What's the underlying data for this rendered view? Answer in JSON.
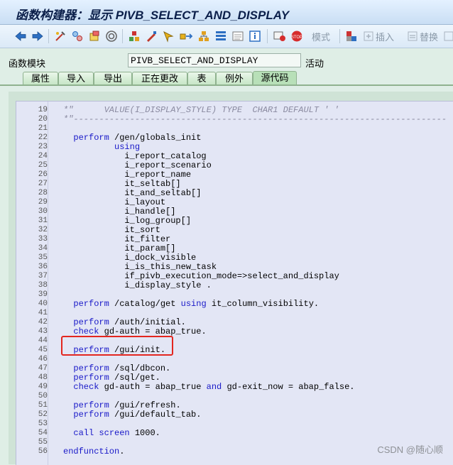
{
  "window": {
    "title": "函数构建器：显示 PIVB_SELECT_AND_DISPLAY"
  },
  "toolbar": {
    "icons": [
      "back-arrow-icon",
      "forward-arrow-icon",
      "other-object-icon",
      "display-change-icon",
      "activate-icon",
      "where-used-icon",
      "object-list-icon",
      "check-icon",
      "navigate-icon",
      "hierarchy-icon",
      "outline-icon",
      "test-icon",
      "info-icon",
      "breakpoint-icon",
      "stop-icon",
      "enhance-icon",
      "insert-icon",
      "replace-icon",
      "delete-icon"
    ],
    "pattern_label": "模式",
    "insert_label": "插入",
    "replace_label": "替换"
  },
  "module": {
    "label": "函数模块",
    "name": "PIVB_SELECT_AND_DISPLAY",
    "status": "活动"
  },
  "tabs": [
    "属性",
    "导入",
    "导出",
    "正在更改",
    "表",
    "例外",
    "源代码"
  ],
  "active_tab": "源代码",
  "code": [
    {
      "n": "19",
      "t": "*\"      VALUE(I_DISPLAY_STYLE) TYPE  CHAR1 DEFAULT ' '"
    },
    {
      "n": "20",
      "t": "*\"-------------------------------------------------------------------------"
    },
    {
      "n": "21",
      "t": ""
    },
    {
      "n": "22",
      "t": "  perform /gen/globals_init"
    },
    {
      "n": "23",
      "t": "          using"
    },
    {
      "n": "24",
      "t": "            i_report_catalog"
    },
    {
      "n": "25",
      "t": "            i_report_scenario"
    },
    {
      "n": "26",
      "t": "            i_report_name"
    },
    {
      "n": "27",
      "t": "            it_seltab[]"
    },
    {
      "n": "28",
      "t": "            it_and_seltab[]"
    },
    {
      "n": "29",
      "t": "            i_layout"
    },
    {
      "n": "30",
      "t": "            i_handle[]"
    },
    {
      "n": "31",
      "t": "            i_log_group[]"
    },
    {
      "n": "32",
      "t": "            it_sort"
    },
    {
      "n": "33",
      "t": "            it_filter"
    },
    {
      "n": "34",
      "t": "            it_param[]"
    },
    {
      "n": "35",
      "t": "            i_dock_visible"
    },
    {
      "n": "36",
      "t": "            i_is_this_new_task"
    },
    {
      "n": "37",
      "t": "            if_pivb_execution_mode=>select_and_display"
    },
    {
      "n": "38",
      "t": "            i_display_style ."
    },
    {
      "n": "39",
      "t": ""
    },
    {
      "n": "40",
      "t": "  perform /catalog/get using it_column_visibility."
    },
    {
      "n": "41",
      "t": ""
    },
    {
      "n": "42",
      "t": "  perform /auth/initial."
    },
    {
      "n": "43",
      "t": "  check gd-auth = abap_true."
    },
    {
      "n": "44",
      "t": ""
    },
    {
      "n": "45",
      "t": "  perform /gui/init."
    },
    {
      "n": "46",
      "t": ""
    },
    {
      "n": "47",
      "t": "  perform /sql/dbcon."
    },
    {
      "n": "48",
      "t": "  perform /sql/get."
    },
    {
      "n": "49",
      "t": "  check gd-auth = abap_true and gd-exit_now = abap_false."
    },
    {
      "n": "50",
      "t": ""
    },
    {
      "n": "51",
      "t": "  perform /gui/refresh."
    },
    {
      "n": "52",
      "t": "  perform /gui/default_tab."
    },
    {
      "n": "53",
      "t": ""
    },
    {
      "n": "54",
      "t": "  call screen 1000."
    },
    {
      "n": "55",
      "t": ""
    },
    {
      "n": "56",
      "t": "endfunction."
    }
  ],
  "watermark": "CSDN @随心顺",
  "colors": {
    "keyword": "#1818c8",
    "comment": "#8a8aa0",
    "highlight": "#e3261f"
  }
}
